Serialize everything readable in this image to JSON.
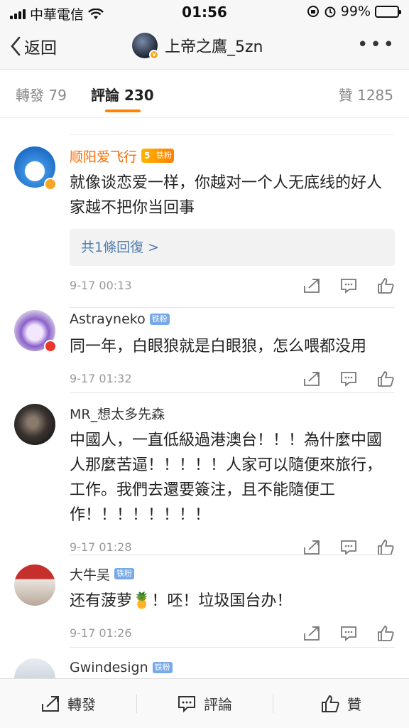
{
  "status": {
    "carrier": "中華電信",
    "time": "01:56",
    "battery": "99%"
  },
  "nav": {
    "back_label": "返回",
    "title": "上帝之鷹_5zn"
  },
  "tabs": [
    {
      "label": "轉發 79"
    },
    {
      "label": "評論 230"
    },
    {
      "label": "贊 1285"
    }
  ],
  "comments": [
    {
      "name": "顺阳爱飞行",
      "badge": "铁粉",
      "text": "就像谈恋爱一样，你越对一个人无底线的好人家越不把你当回事",
      "reply": "共1條回復 >",
      "time": "9-17 00:13"
    },
    {
      "name": "Astrayneko",
      "badge": "铁粉",
      "text": "同一年，白眼狼就是白眼狼，怎么喂都没用",
      "time": "9-17 01:32"
    },
    {
      "name": "MR_想太多先森",
      "text": "中國人，一直低級過港澳台！！！為什麼中國人那麼苦逼！！！！！人家可以隨便來旅行，工作。我們去還要簽注，且不能隨便工作！！！！！！！！",
      "time": "9-17 01:28"
    },
    {
      "name": "大牛吴",
      "badge": "铁粉",
      "text": "还有菠萝🍍！呸！垃圾国台办！",
      "time": "9-17 01:26"
    },
    {
      "name": "Gwindesign",
      "badge": "铁粉"
    }
  ],
  "bottom": {
    "repost": "轉發",
    "comment": "評論",
    "like": "贊"
  },
  "colors": {
    "accent": "#ff8200",
    "link": "#507daf",
    "orange_name": "#f86b00"
  }
}
